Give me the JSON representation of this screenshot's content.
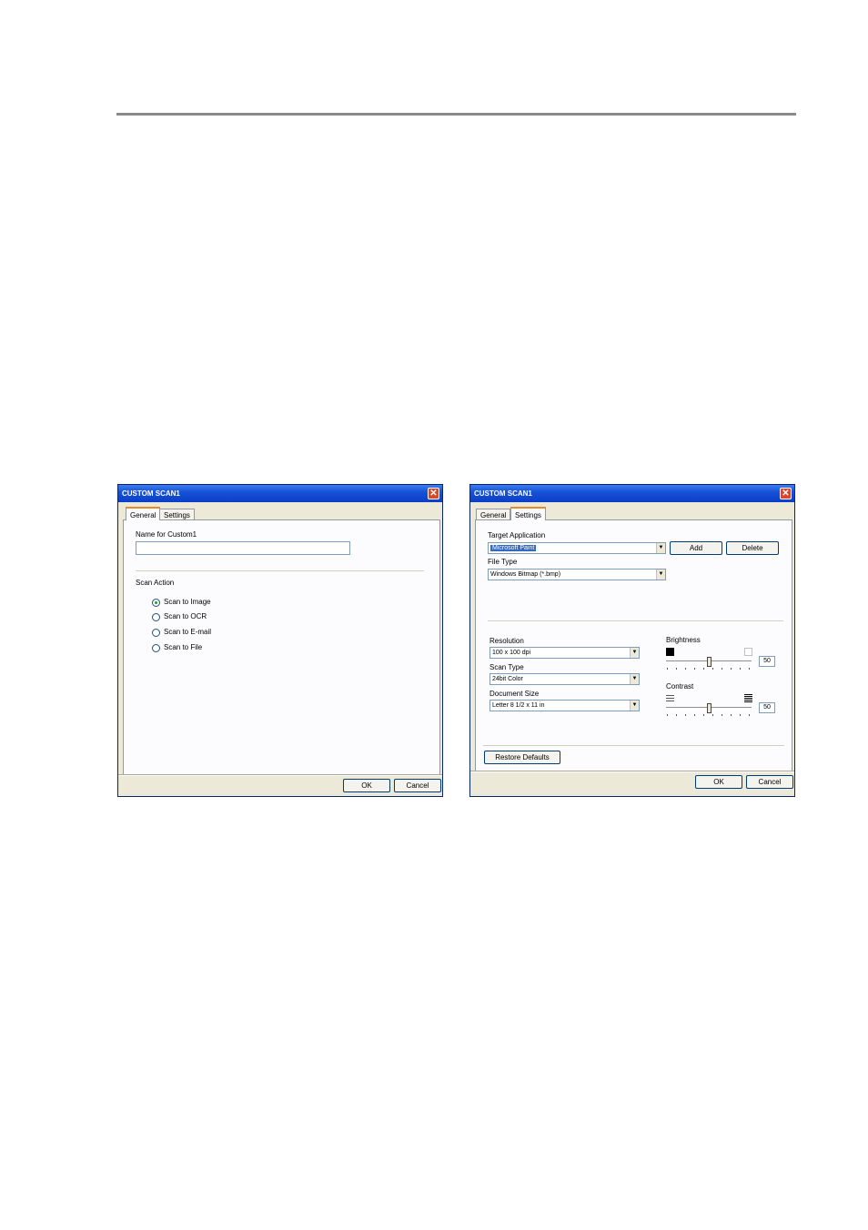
{
  "dialog_general": {
    "title": "CUSTOM SCAN1",
    "close_glyph": "✕",
    "tabs": [
      "General",
      "Settings"
    ],
    "active_tab": "General",
    "name_label": "Name for Custom1",
    "name_value": "",
    "scan_action_label": "Scan Action",
    "scan_actions": [
      {
        "label": "Scan to Image",
        "selected": true
      },
      {
        "label": "Scan to OCR",
        "selected": false
      },
      {
        "label": "Scan to E-mail",
        "selected": false
      },
      {
        "label": "Scan to File",
        "selected": false
      }
    ],
    "ok_label": "OK",
    "cancel_label": "Cancel"
  },
  "dialog_settings": {
    "title": "CUSTOM SCAN1",
    "close_glyph": "✕",
    "tabs": [
      "General",
      "Settings"
    ],
    "active_tab": "Settings",
    "target_application_label": "Target Application",
    "target_application_value": "Microsoft Paint",
    "add_label": "Add",
    "delete_label": "Delete",
    "file_type_label": "File Type",
    "file_type_value": "Windows Bitmap (*.bmp)",
    "resolution_label": "Resolution",
    "resolution_value": "100 x 100 dpi",
    "scan_type_label": "Scan Type",
    "scan_type_value": "24bit Color",
    "document_size_label": "Document Size",
    "document_size_value": "Letter 8 1/2 x 11 in",
    "brightness_label": "Brightness",
    "brightness_value": "50",
    "contrast_label": "Contrast",
    "contrast_value": "50",
    "restore_defaults_label": "Restore Defaults",
    "ok_label": "OK",
    "cancel_label": "Cancel",
    "arrow_glyph": "▼"
  },
  "colors": {
    "title_bar": "#0a3fc7",
    "dialog_face": "#ece9d8",
    "selection": "#316ac5",
    "close_button": "#d9482b"
  }
}
